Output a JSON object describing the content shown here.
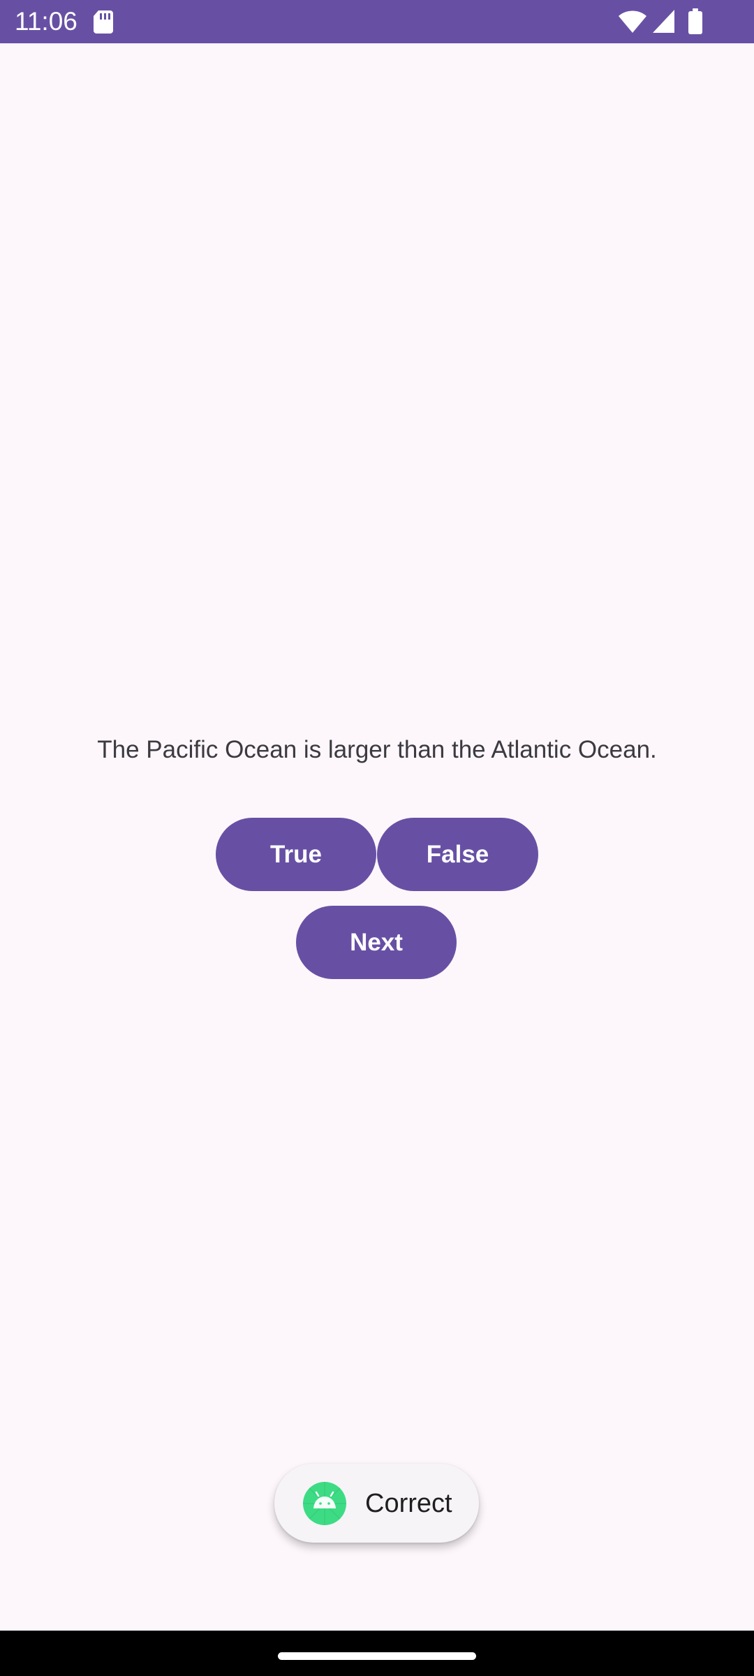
{
  "status_bar": {
    "time": "11:06",
    "background_color": "#6750a4",
    "icons": [
      "sd-card-icon",
      "wifi-icon",
      "cellular-signal-icon",
      "battery-icon"
    ]
  },
  "quiz": {
    "question": "The Pacific Ocean is larger than the Atlantic Ocean.",
    "buttons": {
      "true_label": "True",
      "false_label": "False",
      "next_label": "Next"
    },
    "button_color": "#6750a4"
  },
  "toast": {
    "message": "Correct",
    "icon": "android-app-icon"
  },
  "navigation": {
    "home_indicator": "home-indicator"
  }
}
